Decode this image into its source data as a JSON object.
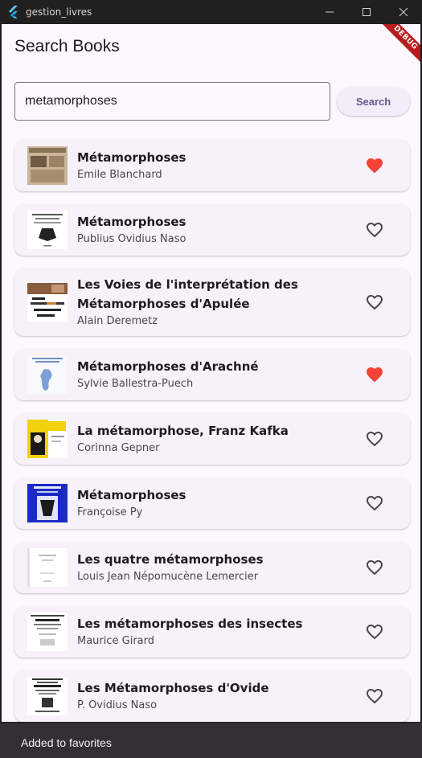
{
  "window": {
    "title": "gestion_livres",
    "controls": [
      "minimize-icon",
      "maximize-icon",
      "close-icon"
    ]
  },
  "appbar": {
    "title": "Search Books",
    "debug_banner": "DEBUG"
  },
  "search": {
    "value": "metamorphoses",
    "button_label": "Search"
  },
  "colors": {
    "favorite_active": "#f44336",
    "favorite_inactive": "#49454f",
    "accent": "#65558f"
  },
  "books": [
    {
      "title": "Métamorphoses",
      "author": "Emile Blanchard",
      "favorite": true
    },
    {
      "title": "Métamorphoses",
      "author": "Publius Ovidius Naso",
      "favorite": false
    },
    {
      "title": "Les Voies de l'interprétation des Métamorphoses d'Apulée",
      "author": "Alain Deremetz",
      "favorite": false
    },
    {
      "title": "Métamorphoses d'Arachné",
      "author": "Sylvie Ballestra-Puech",
      "favorite": true
    },
    {
      "title": "La métamorphose, Franz Kafka",
      "author": "Corinna Gepner",
      "favorite": false
    },
    {
      "title": "Métamorphoses",
      "author": "Françoise Py",
      "favorite": false
    },
    {
      "title": "Les quatre métamorphoses",
      "author": "Louis Jean Népomucène Lemercier",
      "favorite": false
    },
    {
      "title": "Les métamorphoses des insectes",
      "author": "Maurice Girard",
      "favorite": false
    },
    {
      "title": "Les Métamorphoses d'Ovide",
      "author": "P. Ovidius Naso",
      "favorite": false
    }
  ],
  "snackbar": {
    "message": "Added to favorites"
  }
}
